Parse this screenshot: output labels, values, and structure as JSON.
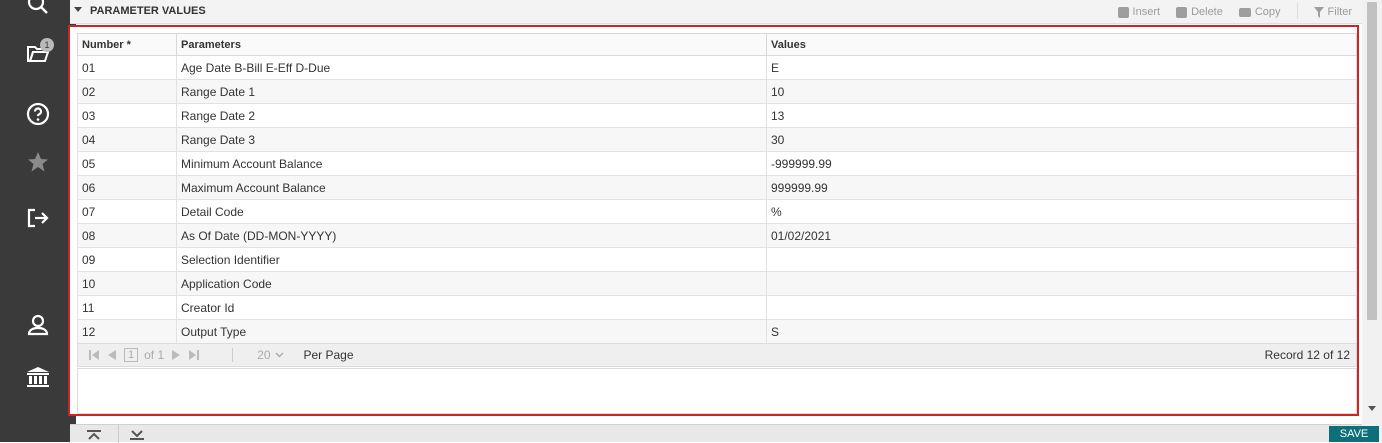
{
  "sidebar": {
    "notification_count": "1"
  },
  "section": {
    "title": "PARAMETER VALUES"
  },
  "toolbar": {
    "insert": "Insert",
    "delete": "Delete",
    "copy": "Copy",
    "filter": "Filter"
  },
  "table": {
    "headers": [
      "Number *",
      "Parameters",
      "Values"
    ],
    "rows": [
      {
        "number": "01",
        "parameter": "Age Date B-Bill E-Eff D-Due",
        "value": "E"
      },
      {
        "number": "02",
        "parameter": "Range Date 1",
        "value": "10"
      },
      {
        "number": "03",
        "parameter": "Range Date 2",
        "value": "13"
      },
      {
        "number": "04",
        "parameter": "Range Date 3",
        "value": "30"
      },
      {
        "number": "05",
        "parameter": "Minimum Account Balance",
        "value": "-999999.99"
      },
      {
        "number": "06",
        "parameter": "Maximum Account Balance",
        "value": "999999.99"
      },
      {
        "number": "07",
        "parameter": "Detail Code",
        "value": "%"
      },
      {
        "number": "08",
        "parameter": "As Of Date (DD-MON-YYYY)",
        "value": "01/02/2021"
      },
      {
        "number": "09",
        "parameter": "Selection Identifier",
        "value": ""
      },
      {
        "number": "10",
        "parameter": "Application Code",
        "value": ""
      },
      {
        "number": "11",
        "parameter": "Creator Id",
        "value": ""
      },
      {
        "number": "12",
        "parameter": "Output Type",
        "value": "S"
      }
    ]
  },
  "pager": {
    "page": "1",
    "of_label": "of 1",
    "per_page_value": "20",
    "per_page_label": "Per Page",
    "record_text": "Record 12 of 12"
  },
  "footer": {
    "save_label": "SAVE"
  }
}
